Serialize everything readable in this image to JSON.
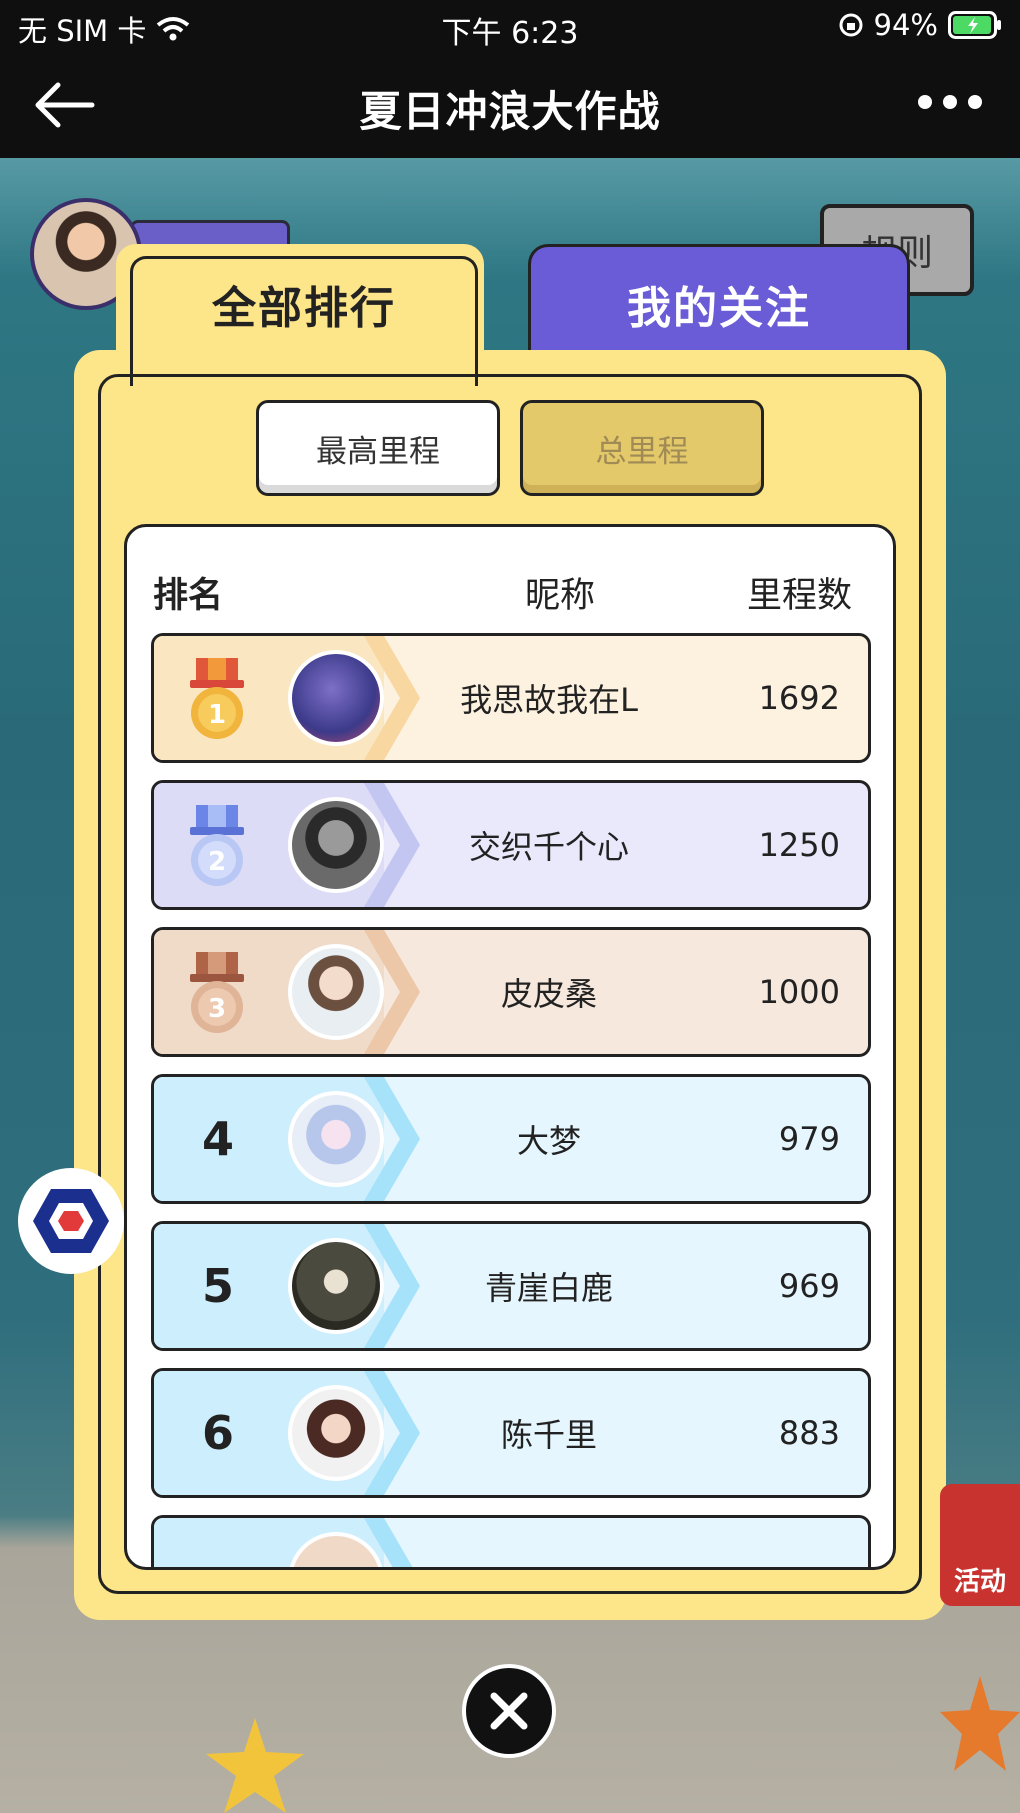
{
  "status_bar": {
    "carrier": "无 SIM 卡",
    "time": "下午 6:23",
    "battery": "94%"
  },
  "nav": {
    "title": "夏日冲浪大作战"
  },
  "rules_button": "规则",
  "tabs": {
    "all_ranking": "全部排行",
    "my_follows": "我的关注"
  },
  "segments": {
    "highest": "最高里程",
    "total": "总里程"
  },
  "table": {
    "headers": {
      "rank": "排名",
      "nickname": "昵称",
      "distance": "里程数"
    },
    "rows": [
      {
        "rank": "1",
        "name": "我思故我在L",
        "score": "1692"
      },
      {
        "rank": "2",
        "name": "交织千个心",
        "score": "1250"
      },
      {
        "rank": "3",
        "name": "皮皮桑",
        "score": "1000"
      },
      {
        "rank": "4",
        "name": "大梦",
        "score": "979"
      },
      {
        "rank": "5",
        "name": "青崖白鹿",
        "score": "969"
      },
      {
        "rank": "6",
        "name": "陈千里",
        "score": "883"
      }
    ]
  },
  "side_promo": "活动",
  "colors": {
    "panel_yellow": "#fde58a",
    "tab_purple": "#6a5cd6",
    "gold": "#f1b43c",
    "silver": "#8fa4ee",
    "bronze": "#c98a6a"
  }
}
